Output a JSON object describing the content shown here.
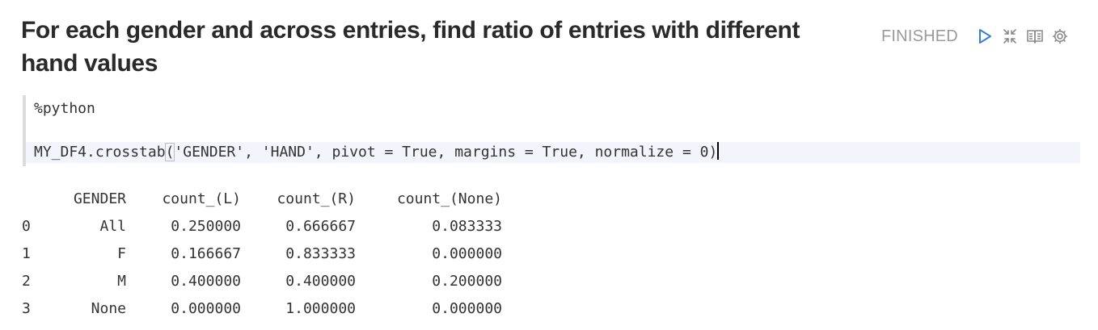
{
  "paragraph": {
    "title": "For each gender and across entries, find ratio of entries with different hand values",
    "status": "FINISHED",
    "icons": [
      "run-icon",
      "collapse-icon",
      "book-icon",
      "settings-icon"
    ]
  },
  "editor": {
    "line1": "%python",
    "line2_before": "MY_DF4.crosstab",
    "line2_paren": "(",
    "line2_after": "'GENDER', 'HAND', pivot = True, margins = True, normalize = 0)"
  },
  "output": {
    "columns": [
      "",
      "GENDER",
      "count_(L)",
      "count_(R)",
      "count_(None)"
    ],
    "rows": [
      [
        "0",
        "All",
        "0.250000",
        "0.666667",
        "0.083333"
      ],
      [
        "1",
        "F",
        "0.166667",
        "0.833333",
        "0.000000"
      ],
      [
        "2",
        "M",
        "0.400000",
        "0.400000",
        "0.200000"
      ],
      [
        "3",
        "None",
        "0.000000",
        "1.000000",
        "0.000000"
      ]
    ]
  }
}
